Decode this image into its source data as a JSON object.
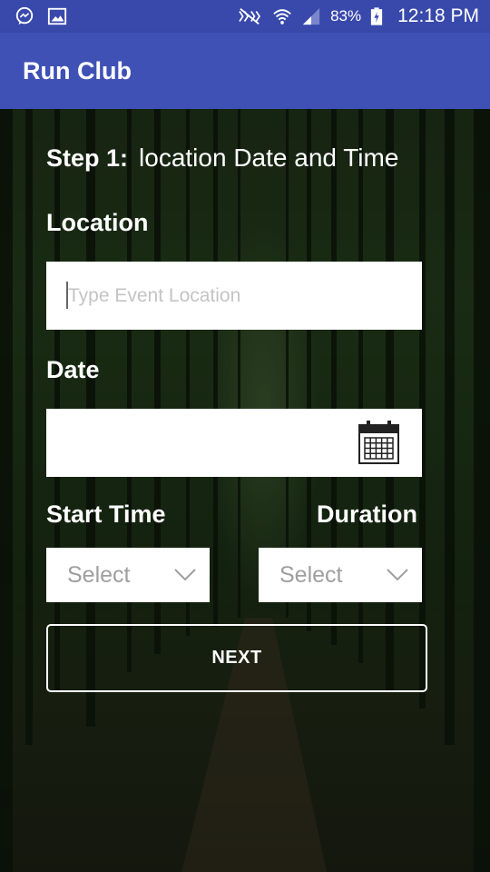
{
  "status_bar": {
    "battery": "83%",
    "time": "12:18 PM",
    "icons": [
      "messenger-icon",
      "image-icon",
      "mute-icon",
      "wifi-icon",
      "signal-icon",
      "battery-charging-icon"
    ]
  },
  "app_bar": {
    "title": "Run Club",
    "color": "#3f51b5"
  },
  "form": {
    "step_label": "Step 1:",
    "step_description": "location Date and Time",
    "location_label": "Location",
    "location_placeholder": "Type Event Location",
    "location_value": "",
    "date_label": "Date",
    "date_value": "",
    "start_time_label": "Start Time",
    "start_time_value": "Select",
    "duration_label": "Duration",
    "duration_value": "Select",
    "next_label": "NEXT"
  }
}
